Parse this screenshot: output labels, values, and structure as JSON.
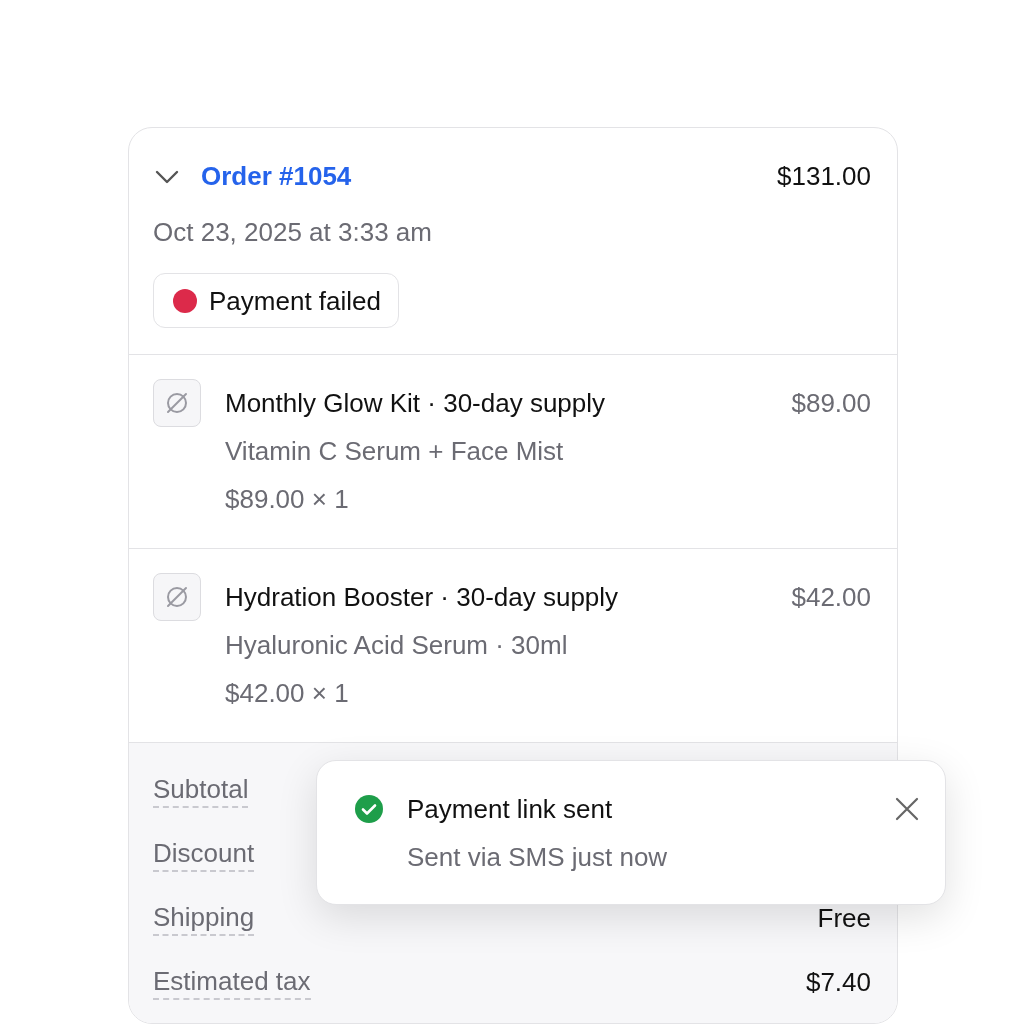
{
  "order": {
    "expanded": true,
    "number": "Order #1054",
    "total": "$131.00",
    "date": "Oct 23, 2025 at 3:33 am",
    "status": {
      "label": "Payment failed",
      "color": "#dc2a4a"
    }
  },
  "items": [
    {
      "title": "Monthly Glow Kit · 30-day supply",
      "price": "$89.00",
      "subtitle": "Vitamin C Serum + Face Mist",
      "quantity": "$89.00 × 1"
    },
    {
      "title": "Hydration Booster · 30-day supply",
      "price": "$42.00",
      "subtitle": "Hyaluronic Acid Serum · 30ml",
      "quantity": "$42.00 × 1"
    }
  ],
  "summary": [
    {
      "label": "Subtotal"
    },
    {
      "label": "Discount"
    },
    {
      "label": "Shipping",
      "value": "Free"
    },
    {
      "label": "Estimated tax",
      "value": "$7.40"
    }
  ],
  "toast": {
    "title": "Payment link sent",
    "message": "Sent via SMS just now"
  }
}
